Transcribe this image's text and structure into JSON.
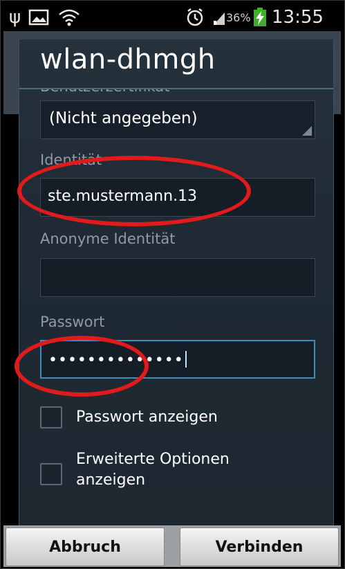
{
  "status_bar": {
    "battery_percent": "36%",
    "time": "13:55",
    "icons": [
      "usb-icon",
      "image-icon",
      "wifi-icon",
      "alarm-icon",
      "signal-icon",
      "battery-charging-icon"
    ]
  },
  "dialog": {
    "title": "wlan-dhmgh",
    "user_certificate": {
      "label": "Benutzerzertifikat",
      "value": "(Nicht angegeben)"
    },
    "identity": {
      "label": "Identität",
      "value": "ste.mustermann.13"
    },
    "anonymous_identity": {
      "label": "Anonyme Identität",
      "value": ""
    },
    "password": {
      "label": "Passwort",
      "value": "••••••••••••••"
    },
    "show_password": {
      "label": "Passwort anzeigen",
      "checked": false
    },
    "advanced_options": {
      "label_line1": "Erweiterte Optionen",
      "label_line2": "anzeigen",
      "checked": false
    },
    "buttons": {
      "cancel": "Abbruch",
      "connect": "Verbinden"
    }
  },
  "colors": {
    "dialog_bg": "#1f2a33",
    "accent": "#3a8fc2",
    "annotation": "#e11a1a"
  }
}
